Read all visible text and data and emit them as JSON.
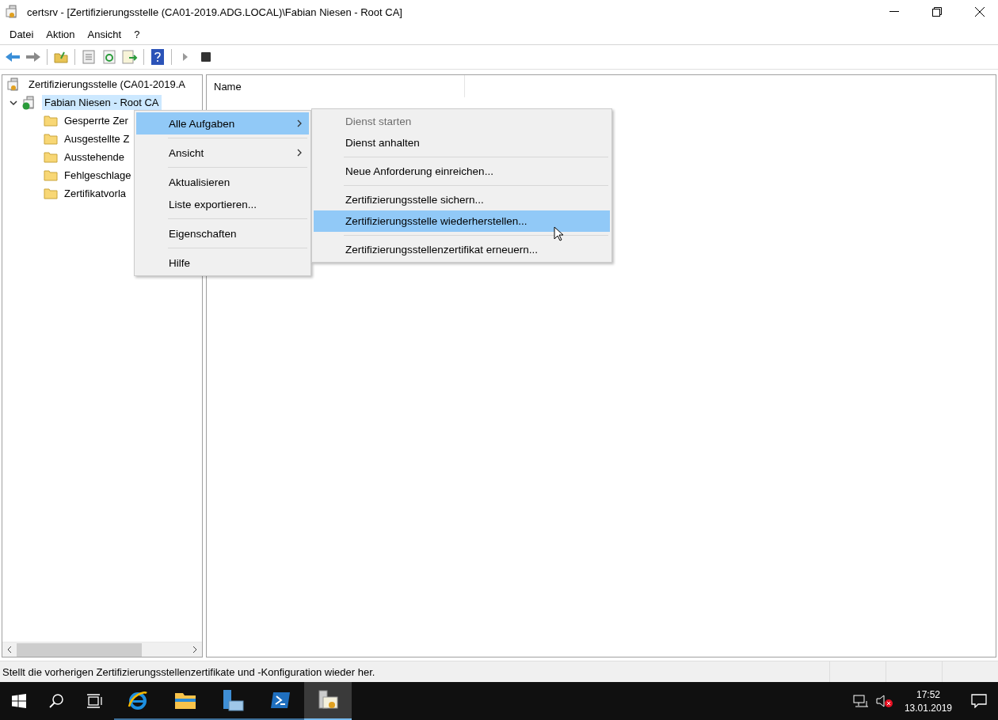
{
  "window": {
    "title": "certsrv - [Zertifizierungsstelle (CA01-2019.ADG.LOCAL)\\Fabian Niesen - Root CA]"
  },
  "menu_bar": [
    "Datei",
    "Aktion",
    "Ansicht",
    "?"
  ],
  "tree": {
    "label": "Zertifizierungsstelle (CA01-2019.A",
    "children": [
      {
        "label": "Fabian Niesen - Root CA",
        "expanded": true,
        "selected": true,
        "children": [
          {
            "label": "Gesperrte Zer"
          },
          {
            "label": "Ausgestellte Z"
          },
          {
            "label": "Ausstehende"
          },
          {
            "label": "Fehlgeschlage"
          },
          {
            "label": "Zertifikatvorla"
          }
        ]
      }
    ]
  },
  "list": {
    "columns": [
      "Name"
    ]
  },
  "context_menu": [
    {
      "kind": "item",
      "label": "Alle Aufgaben",
      "submenu": true,
      "selected": true
    },
    {
      "kind": "separator"
    },
    {
      "kind": "item",
      "label": "Ansicht",
      "submenu": true,
      "selected": false
    },
    {
      "kind": "separator"
    },
    {
      "kind": "item",
      "label": "Aktualisieren",
      "submenu": false,
      "selected": false
    },
    {
      "kind": "item",
      "label": "Liste exportieren...",
      "submenu": false,
      "selected": false
    },
    {
      "kind": "separator"
    },
    {
      "kind": "item",
      "label": "Eigenschaften",
      "submenu": false,
      "selected": false
    },
    {
      "kind": "separator"
    },
    {
      "kind": "item",
      "label": "Hilfe",
      "submenu": false,
      "selected": false
    }
  ],
  "submenu": [
    {
      "kind": "item",
      "label": "Dienst starten",
      "disabled": true,
      "selected": false
    },
    {
      "kind": "item",
      "label": "Dienst anhalten",
      "disabled": false,
      "selected": false
    },
    {
      "kind": "separator"
    },
    {
      "kind": "item",
      "label": "Neue Anforderung einreichen...",
      "disabled": false,
      "selected": false
    },
    {
      "kind": "separator"
    },
    {
      "kind": "item",
      "label": "Zertifizierungsstelle sichern...",
      "disabled": false,
      "selected": false
    },
    {
      "kind": "item",
      "label": "Zertifizierungsstelle wiederherstellen...",
      "disabled": false,
      "selected": true
    },
    {
      "kind": "separator"
    },
    {
      "kind": "item",
      "label": "Zertifizierungsstellenzertifikat erneuern...",
      "disabled": false,
      "selected": false
    }
  ],
  "status_bar": {
    "text": "Stellt die vorherigen Zertifizierungsstellenzertifikate und -Konfiguration wieder her."
  },
  "taskbar": {
    "apps": [
      {
        "kind": "browser",
        "active": false
      },
      {
        "kind": "explorer",
        "active": false
      },
      {
        "kind": "server",
        "active": false
      },
      {
        "kind": "shell",
        "active": false
      },
      {
        "kind": "certsrv",
        "active": true
      }
    ],
    "time": "17:52",
    "date": "13.01.2019"
  }
}
